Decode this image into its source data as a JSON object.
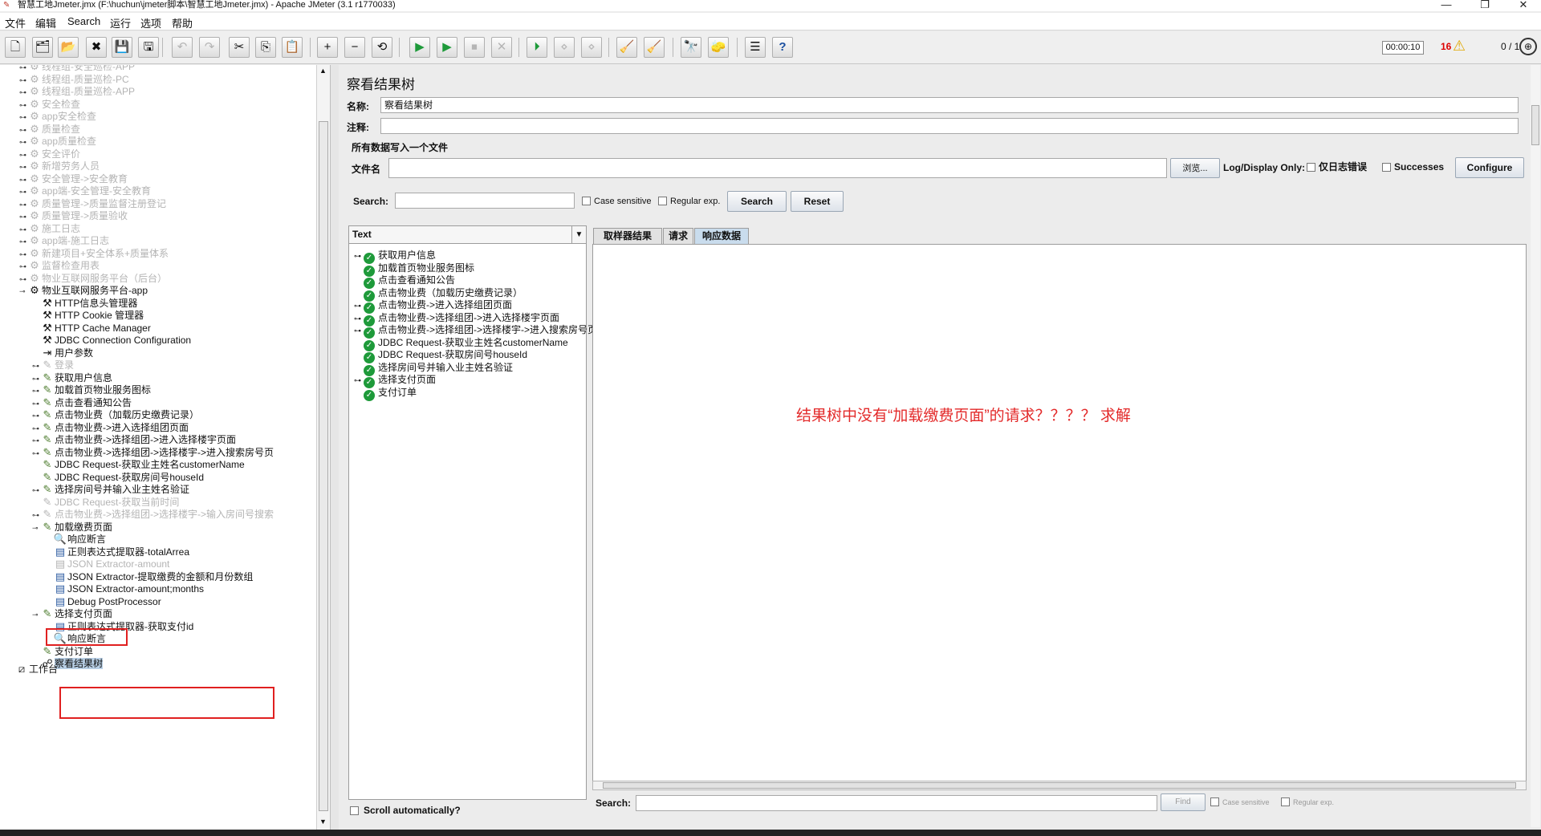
{
  "window": {
    "title": "智慧工地Jmeter.jmx (F:\\huchun\\jmeter脚本\\智慧工地Jmeter.jmx) - Apache JMeter (3.1 r1770033)",
    "controls": {
      "minimize": "—",
      "maximize": "❐",
      "close": "✕"
    }
  },
  "menu": [
    "文件",
    "编辑",
    "Search",
    "运行",
    "选项",
    "帮助"
  ],
  "toolbar": {
    "buttons": [
      {
        "name": "new-icon",
        "glyph": "🗋"
      },
      {
        "name": "templates-icon",
        "glyph": "🗂"
      },
      {
        "name": "open-icon",
        "glyph": "📂"
      },
      {
        "name": "close-icon",
        "glyph": "✖"
      },
      {
        "name": "save-icon",
        "glyph": "💾"
      },
      {
        "name": "save-as-icon",
        "glyph": "🖫"
      },
      {
        "name": "undo-icon",
        "glyph": "↶"
      },
      {
        "name": "redo-icon",
        "glyph": "↷"
      },
      {
        "name": "cut-icon",
        "glyph": "✂"
      },
      {
        "name": "copy-icon",
        "glyph": "⎘"
      },
      {
        "name": "paste-icon",
        "glyph": "📋"
      },
      {
        "name": "expand-all-icon",
        "glyph": "+"
      },
      {
        "name": "collapse-all-icon",
        "glyph": "−"
      },
      {
        "name": "toggle-icon",
        "glyph": "⟲"
      },
      {
        "name": "start-icon",
        "glyph": "▶"
      },
      {
        "name": "start-no-pause-icon",
        "glyph": "▶"
      },
      {
        "name": "stop-icon",
        "glyph": "⏹"
      },
      {
        "name": "shutdown-icon",
        "glyph": "✕"
      },
      {
        "name": "remote-start-icon",
        "glyph": "⏵"
      },
      {
        "name": "remote-stop-icon",
        "glyph": "⋄"
      },
      {
        "name": "remote-shutdown-icon",
        "glyph": "⋄"
      },
      {
        "name": "clear-icon",
        "glyph": "🧹"
      },
      {
        "name": "clear-all-icon",
        "glyph": "🧹"
      },
      {
        "name": "search-icon",
        "glyph": "🔭"
      },
      {
        "name": "reset-search-icon",
        "glyph": "🧽"
      },
      {
        "name": "function-helper-icon",
        "glyph": "☰"
      },
      {
        "name": "help-icon",
        "glyph": "?"
      }
    ],
    "timer": "00:00:10",
    "error_count": "16",
    "warning_icon": "⚠",
    "thread_count": "0 / 1"
  },
  "tree": {
    "nodes": [
      {
        "label": "线程组-安全巡检-APP",
        "disabled": true,
        "icon": "gear-icon"
      },
      {
        "label": "线程组-质量巡检-PC",
        "disabled": true,
        "icon": "gear-icon"
      },
      {
        "label": "线程组-质量巡检-APP",
        "disabled": true,
        "icon": "gear-icon"
      },
      {
        "label": "安全检查",
        "disabled": true,
        "icon": "gear-icon"
      },
      {
        "label": "app安全检查",
        "disabled": true,
        "icon": "gear-icon"
      },
      {
        "label": "质量检查",
        "disabled": true,
        "icon": "gear-icon"
      },
      {
        "label": "app质量检查",
        "disabled": true,
        "icon": "gear-icon"
      },
      {
        "label": "安全评价",
        "disabled": true,
        "icon": "gear-icon"
      },
      {
        "label": "新增劳务人员",
        "disabled": true,
        "icon": "gear-icon"
      },
      {
        "label": "安全管理->安全教育",
        "disabled": true,
        "icon": "gear-icon"
      },
      {
        "label": "app端-安全管理-安全教育",
        "disabled": true,
        "icon": "gear-icon"
      },
      {
        "label": "质量管理->质量监督注册登记",
        "disabled": true,
        "icon": "gear-icon"
      },
      {
        "label": "质量管理->质量验收",
        "disabled": true,
        "icon": "gear-icon"
      },
      {
        "label": "施工日志",
        "disabled": true,
        "icon": "gear-icon"
      },
      {
        "label": "app端-施工日志",
        "disabled": true,
        "icon": "gear-icon"
      },
      {
        "label": "新建项目+安全体系+质量体系",
        "disabled": true,
        "icon": "gear-icon"
      },
      {
        "label": "监督检查用表",
        "disabled": true,
        "icon": "gear-icon"
      },
      {
        "label": "物业互联网服务平台（后台）",
        "disabled": true,
        "icon": "gear-icon"
      },
      {
        "label": "物业互联网服务平台-app",
        "disabled": false,
        "icon": "gear-icon"
      },
      {
        "label": "HTTP信息头管理器",
        "disabled": false,
        "icon": "wrench-icon"
      },
      {
        "label": "HTTP Cookie 管理器",
        "disabled": false,
        "icon": "wrench-icon"
      },
      {
        "label": "HTTP Cache Manager",
        "disabled": false,
        "icon": "wrench-icon"
      },
      {
        "label": "JDBC Connection Configuration",
        "disabled": false,
        "icon": "wrench-icon"
      },
      {
        "label": "用户参数",
        "disabled": false,
        "icon": "user-param-icon"
      },
      {
        "label": "登录",
        "disabled": true,
        "icon": "sampler-icon"
      },
      {
        "label": "获取用户信息",
        "disabled": false,
        "icon": "sampler-icon"
      },
      {
        "label": "加载首页物业服务图标",
        "disabled": false,
        "icon": "sampler-icon"
      },
      {
        "label": "点击查看通知公告",
        "disabled": false,
        "icon": "sampler-icon"
      },
      {
        "label": "点击物业费（加载历史缴费记录）",
        "disabled": false,
        "icon": "sampler-icon"
      },
      {
        "label": "点击物业费->进入选择组团页面",
        "disabled": false,
        "icon": "sampler-icon"
      },
      {
        "label": "点击物业费->选择组团->进入选择楼宇页面",
        "disabled": false,
        "icon": "sampler-icon"
      },
      {
        "label": "点击物业费->选择组团->选择楼宇->进入搜索房号页",
        "disabled": false,
        "icon": "sampler-icon"
      },
      {
        "label": "JDBC Request-获取业主姓名customerName",
        "disabled": false,
        "icon": "sampler-icon"
      },
      {
        "label": "JDBC Request-获取房间号houseId",
        "disabled": false,
        "icon": "sampler-icon"
      },
      {
        "label": "选择房间号并输入业主姓名验证",
        "disabled": false,
        "icon": "sampler-icon"
      },
      {
        "label": "JDBC Request-获取当前时间",
        "disabled": true,
        "icon": "sampler-icon"
      },
      {
        "label": "点击物业费->选择组团->选择楼宇->输入房间号搜索",
        "disabled": true,
        "icon": "sampler-icon"
      },
      {
        "label": "加载缴费页面",
        "disabled": false,
        "icon": "sampler-icon"
      },
      {
        "label": "响应断言",
        "disabled": false,
        "icon": "assertion-icon"
      },
      {
        "label": "正则表达式提取器-totalArrea",
        "disabled": false,
        "icon": "extractor-icon"
      },
      {
        "label": "JSON Extractor-amount",
        "disabled": true,
        "icon": "extractor-icon"
      },
      {
        "label": "JSON Extractor-提取缴费的金额和月份数组",
        "disabled": false,
        "icon": "extractor-icon"
      },
      {
        "label": "JSON Extractor-amount;months",
        "disabled": false,
        "icon": "extractor-icon"
      },
      {
        "label": "Debug PostProcessor",
        "disabled": false,
        "icon": "extractor-icon"
      },
      {
        "label": "选择支付页面",
        "disabled": false,
        "icon": "sampler-icon"
      },
      {
        "label": "正则表达式提取器-获取支付id",
        "disabled": false,
        "icon": "extractor-icon"
      },
      {
        "label": "响应断言",
        "disabled": false,
        "icon": "assertion-icon"
      },
      {
        "label": "支付订单",
        "disabled": false,
        "icon": "sampler-icon"
      },
      {
        "label": "察看结果树",
        "disabled": false,
        "icon": "listener-icon"
      },
      {
        "label": "工作台",
        "disabled": false,
        "icon": "workbench-icon"
      }
    ]
  },
  "panel": {
    "title": "察看结果树",
    "name_label": "名称:",
    "name_value": "察看结果树",
    "comment_label": "注释:",
    "comment_value": "",
    "file_group_title": "所有数据写入一个文件",
    "filename_label": "文件名",
    "filename_value": "",
    "browse_button": "浏览...",
    "log_display_label": "Log/Display Only:",
    "errors_only_label": "仅日志错误",
    "successes_label": "Successes",
    "configure_button": "Configure",
    "search_label": "Search:",
    "search_value": "",
    "case_sensitive_label": "Case sensitive",
    "regular_exp_label": "Regular exp.",
    "search_button": "Search",
    "reset_button": "Reset",
    "renderer": "Text",
    "results": [
      {
        "label": "获取用户信息",
        "expandable": true
      },
      {
        "label": "加载首页物业服务图标",
        "expandable": false
      },
      {
        "label": "点击查看通知公告",
        "expandable": false
      },
      {
        "label": "点击物业费（加载历史缴费记录）",
        "expandable": false
      },
      {
        "label": "点击物业费->进入选择组团页面",
        "expandable": true
      },
      {
        "label": "点击物业费->选择组团->进入选择楼宇页面",
        "expandable": true
      },
      {
        "label": "点击物业费->选择组团->选择楼宇->进入搜索房号页",
        "expandable": true
      },
      {
        "label": "JDBC Request-获取业主姓名customerName",
        "expandable": false
      },
      {
        "label": "JDBC Request-获取房间号houseId",
        "expandable": false
      },
      {
        "label": "选择房间号并输入业主姓名验证",
        "expandable": false
      },
      {
        "label": "选择支付页面",
        "expandable": true
      },
      {
        "label": "支付订单",
        "expandable": false
      }
    ],
    "annotation": "结果树中没有“加载缴费页面”的请求？？？？ 求解",
    "scroll_auto_label": "Scroll automatically?",
    "tabs": [
      "取样器结果",
      "请求",
      "响应数据"
    ],
    "active_tab": "响应数据",
    "bottom_search_label": "Search:",
    "find_button": "Find",
    "bottom_case_sensitive": "Case sensitive",
    "bottom_regular_exp": "Regular exp."
  },
  "colors": {
    "accent": "#c9dced",
    "annotation": "#e32a2a",
    "error_count": "#dd0000",
    "success": "#1e9a3a"
  }
}
